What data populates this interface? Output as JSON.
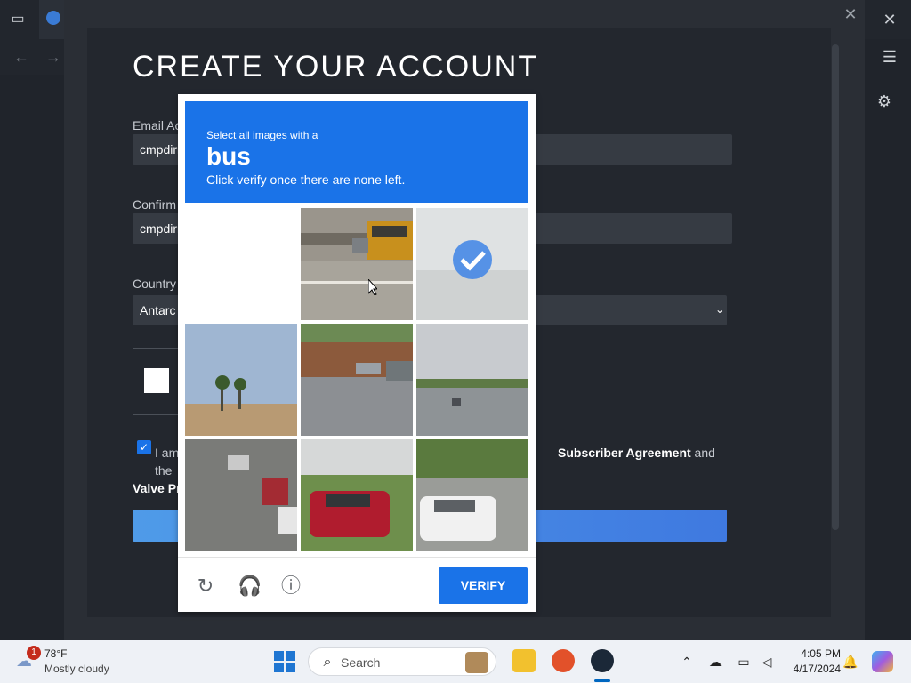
{
  "dialog": {
    "title": "CREATE YOUR ACCOUNT",
    "email_label": "Email Ac",
    "email_value": "cmpdirr",
    "confirm_label": "Confirm",
    "confirm_value": "cmpdirr",
    "country_label": "Country",
    "country_value": "Antarc",
    "terms_prefix": "I am",
    "terms_link1": "Subscriber Agreement",
    "terms_middle": "and the",
    "terms_link2": "Valve Pr"
  },
  "captcha": {
    "prompt_small": "Select all images with a",
    "target_word": "bus",
    "instruction": "Click verify once there are none left.",
    "verify_label": "VERIFY",
    "selected_tiles": [
      2
    ],
    "accent_color": "#1a73e8"
  },
  "taskbar": {
    "weather_badge": "1",
    "weather_temp": "78°F",
    "weather_desc": "Mostly cloudy",
    "search_label": "Search",
    "time": "4:05 PM",
    "date": "4/17/2024"
  },
  "icons": {
    "close": "✕",
    "back": "←",
    "forward": "→",
    "menu": "☰",
    "gear": "⚙",
    "chevron": "⌄",
    "reload": "↻",
    "audio": "🎧",
    "info": "ⓘ",
    "search": "⌕",
    "check": "✓"
  }
}
